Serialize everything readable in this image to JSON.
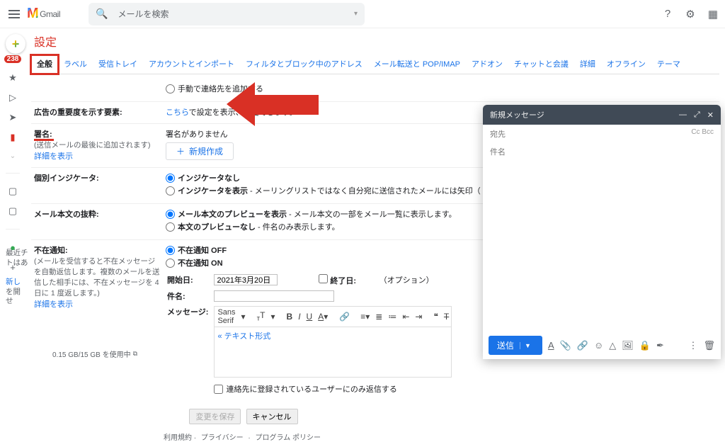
{
  "header": {
    "search_placeholder": "メールを検索",
    "logo_text": "Gmail"
  },
  "sidebar": {
    "unread": "238"
  },
  "recent_talked": {
    "line1": "最近チ",
    "line2": "トはあ",
    "new_label": "新し",
    "line3": "を開",
    "line4": "せ"
  },
  "settings": {
    "title": "設定",
    "tabs": [
      "全般",
      "ラベル",
      "受信トレイ",
      "アカウントとインポート",
      "フィルタとブロック中のアドレス",
      "メール転送と POP/IMAP",
      "アドオン",
      "チャットと会議",
      "詳細",
      "オフライン",
      "テーマ"
    ],
    "contacts_manual": "手動で連絡先を追加する",
    "ad_importance_label": "広告の重要度を示す要素:",
    "ad_importance_value_prefix": "こちら",
    "ad_importance_value_suffix": "で設定を表示、変更できます。",
    "signature_label": "署名:",
    "signature_sub": "(送信メールの最後に追加されます)",
    "detail_link": "詳細を表示",
    "no_signature": "署名がありません",
    "new_signature_btn": "新規作成",
    "indicator_label": "個別インジケータ:",
    "indicator_none": "インジケータなし",
    "indicator_show": "インジケータを表示",
    "indicator_show_desc": " - メーリングリストではなく自分宛に送信されたメールには矢印（ › ）が、自分だけに送信されたメール…",
    "preview_label": "メール本文の抜粋:",
    "preview_on": "メール本文のプレビューを表示",
    "preview_on_desc": " - メール本文の一部をメール一覧に表示します。",
    "preview_off": "本文のプレビューなし",
    "preview_off_desc": " - 件名のみ表示します。",
    "ooo_label": "不在通知:",
    "ooo_sub": "(メールを受信すると不在メッセージを自動返信します。複数のメールを送信した相手には、不在メッセージを 4 日に 1 度返します。)",
    "ooo_off": "不在通知 OFF",
    "ooo_on": "不在通知 ON",
    "ooo_start": "開始日:",
    "ooo_start_val": "2021年3月20日",
    "ooo_end": "終了日:",
    "ooo_end_opt": "（オプション）",
    "ooo_subject": "件名:",
    "ooo_message": "メッセージ:",
    "font_family": "Sans Serif",
    "plain_text": "« テキスト形式",
    "ooo_contacts_only": "連絡先に登録されているユーザーにのみ返信する",
    "save_btn": "変更を保存",
    "cancel_btn": "キャンセル"
  },
  "footer": {
    "prefix": "利用規約",
    "privacy": "プライバシー",
    "program": "プログラム ポリシー"
  },
  "storage": {
    "text": "0.15 GB/15 GB を使用中"
  },
  "composer": {
    "title": "新規メッセージ",
    "to": "宛先",
    "cc": "Cc",
    "bcc": "Bcc",
    "subject": "件名",
    "send": "送信"
  }
}
